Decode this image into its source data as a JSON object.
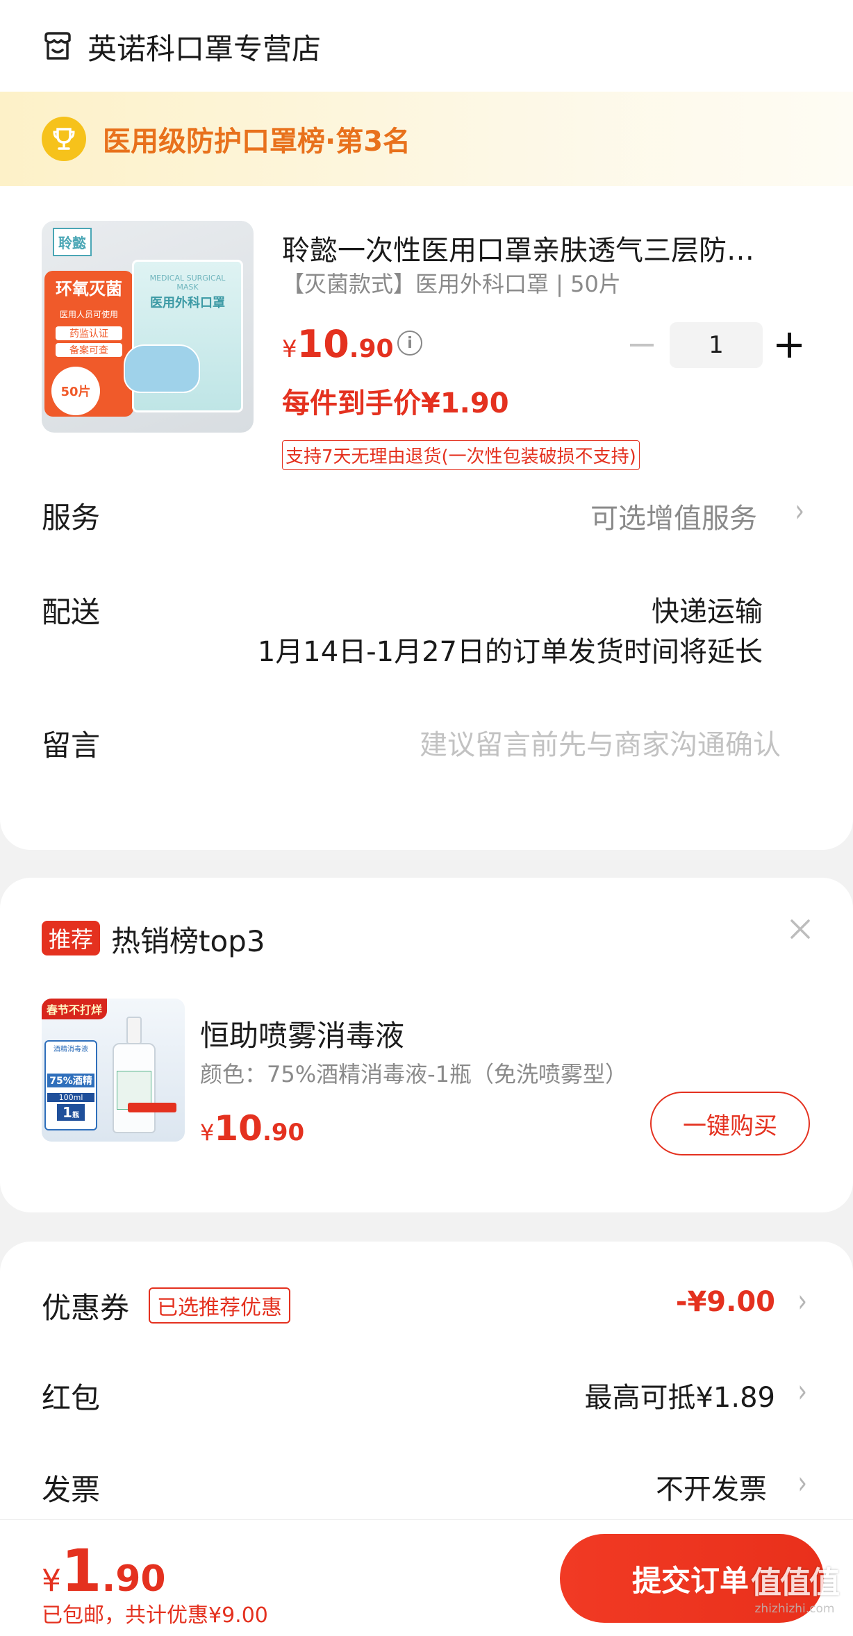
{
  "store": {
    "icon": "store-icon",
    "name": "英诺科口罩专营店"
  },
  "rank_banner": {
    "icon": "trophy-icon",
    "text": "医用级防护口罩榜·第3名"
  },
  "product": {
    "image_brand": "聆懿",
    "image_badge1": "环氧灭菌",
    "image_badge2": "医用人员可使用",
    "image_badge3": "药监认证",
    "image_badge4": "备案可查",
    "image_count": "50片",
    "image_pack_en": "MEDICAL SURGICAL MASK",
    "image_pack_cn": "医用外科口罩",
    "title": "聆懿一次性医用口罩亲肤透气三层防…",
    "spec": "【灭菌款式】医用外科口罩 | 50片",
    "price_symbol": "¥",
    "price_int": "10",
    "price_dec": ".90",
    "info_icon": "info-icon",
    "qty": "1",
    "per_item_price": "每件到手价¥1.90",
    "return_policy": "支持7天无理由退货(一次性包装破损不支持)"
  },
  "rows": {
    "service_label": "服务",
    "service_value": "可选增值服务",
    "delivery_label": "配送",
    "delivery_value": "快递运输",
    "delivery_note": "1月14日-1月27日的订单发货时间将延长",
    "message_label": "留言",
    "message_placeholder": "建议留言前先与商家沟通确认"
  },
  "recommend": {
    "tag": "推荐",
    "title": "热销榜top3",
    "close_icon": "close-icon",
    "image_ribbon": "春节不打烊",
    "image_label1": "酒精消毒液",
    "image_label2": "75%酒精",
    "image_label3": "100ml",
    "image_label4": "1",
    "image_label5": "瓶",
    "product_name": "恒助喷雾消毒液",
    "product_spec": "颜色：75%酒精消毒液-1瓶（免洗喷雾型）",
    "price_symbol": "¥",
    "price_int": "10",
    "price_dec": ".90",
    "buy_button": "一键购买"
  },
  "discounts": {
    "coupon_label": "优惠券",
    "coupon_tag": "已选推荐优惠",
    "coupon_value": "-¥9.00",
    "redpacket_label": "红包",
    "redpacket_value": "最高可抵¥1.89",
    "invoice_label": "发票",
    "invoice_value": "不开发票"
  },
  "footer": {
    "total_symbol": "¥",
    "total_int": "1",
    "total_dec": ".90",
    "shipping_note": "已包邮，共计优惠¥9.00",
    "submit_button": "提交订单",
    "watermark": "值值值",
    "watermark_sub": "zhizhizhi.com"
  },
  "colors": {
    "accent": "#e4311f",
    "banner_text": "#e8711c",
    "banner_bg": "#fdf6dc",
    "trophy": "#f6c21b"
  }
}
